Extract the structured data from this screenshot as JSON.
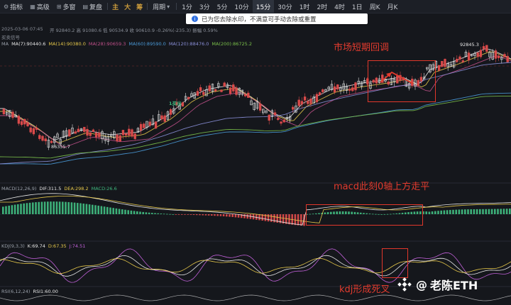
{
  "toolbar": {
    "left_items": [
      {
        "icon": "indicator-icon",
        "label": "指标"
      },
      {
        "icon": "grid-icon",
        "label": "高级"
      },
      {
        "icon": "multiwindow-icon",
        "label": "多窗"
      },
      {
        "icon": "replay-icon",
        "label": "复盘"
      }
    ],
    "cn_buttons": [
      "主",
      "大",
      "筹"
    ],
    "period_label": "周期",
    "timeframes": [
      "1分",
      "3分",
      "5分",
      "10分",
      "15分",
      "30分",
      "1时",
      "2时",
      "4时",
      "1日",
      "周K",
      "月K"
    ],
    "active_timeframe": "15分"
  },
  "toast": {
    "text": "已为您去除水印，不满意可手动去除或重置"
  },
  "header": {
    "date_line": "2025-03-06 07:45",
    "ohlc_line": "开 92840.2  高 91080.6  低 90534.9  收 90610.9  -0.26%(-235.3)  振幅 0.59%",
    "sub_label": "买卖信号"
  },
  "ma_legend": [
    {
      "label": "MA",
      "color": "#9aa0aa"
    },
    {
      "label": "MA(7):90440.6",
      "color": "#e6e6e6"
    },
    {
      "label": "MA(14):90380.0",
      "color": "#e6c84a"
    },
    {
      "label": "MA(28):90659.3",
      "color": "#c0508a"
    },
    {
      "label": "MA(60):89590.0",
      "color": "#4a9ad8"
    },
    {
      "label": "MA(120):88476.0",
      "color": "#8a8fd8"
    },
    {
      "label": "MA(200):86725.2",
      "color": "#7ac04a"
    }
  ],
  "price_labels": {
    "high": "92845.3",
    "low": "86355.7",
    "signal": "1买出"
  },
  "annotations": {
    "short_pullback": "市场短期回调",
    "macd_flat": "macd此刻0轴上方走平",
    "kdj_cross": "kdj形成死叉"
  },
  "macd_legend": [
    {
      "label": "MACD(12,26,9)",
      "color": "#9aa0aa"
    },
    {
      "label": "DIF:311.5",
      "color": "#e6e6e6"
    },
    {
      "label": "DEA:298.2",
      "color": "#e6c84a"
    },
    {
      "label": "MACD:26.6",
      "color": "#3fb87e"
    }
  ],
  "kdj_legend": [
    {
      "label": "KDJ(9,3,3)",
      "color": "#9aa0aa"
    },
    {
      "label": "K:69.74",
      "color": "#e6e6e6"
    },
    {
      "label": "D:67.35",
      "color": "#e6c84a"
    },
    {
      "label": "J:74.51",
      "color": "#c060d8"
    }
  ],
  "rsi_legend": [
    {
      "label": "RSI(6,12,24)",
      "color": "#9aa0aa"
    },
    {
      "label": "RSI1:60.00",
      "color": "#e6e6e6"
    }
  ],
  "watermark": {
    "at": "@",
    "name": "老陈ETH"
  },
  "colors": {
    "up": "#e0e0e0",
    "down": "#d84a4a",
    "bull_hist": "#3fb87e",
    "bear_hist": "#d84a4a",
    "annotation": "#e23b2e"
  }
}
